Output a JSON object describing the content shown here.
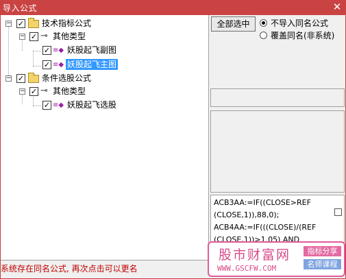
{
  "window": {
    "title": "导入公式",
    "close_glyph": "✕"
  },
  "tree": {
    "root1": {
      "label": "技术指标公式",
      "expander": "−",
      "check": "✓",
      "icon": "folder-icon"
    },
    "group1": {
      "label": "其他类型",
      "expander": "−",
      "check": "✓",
      "icon": "key-icon"
    },
    "item1": {
      "label": "妖股起飞副图",
      "check": "✓",
      "icon": "formula-icon"
    },
    "item2": {
      "label": "妖股起飞主图",
      "check": "✓",
      "icon": "formula-icon",
      "selected": true
    },
    "root2": {
      "label": "条件选股公式",
      "expander": "−",
      "check": "✓",
      "icon": "folder-icon"
    },
    "group2": {
      "label": "其他类型",
      "expander": "−",
      "check": "✓",
      "icon": "key-icon"
    },
    "item3": {
      "label": "妖股起飞选股",
      "check": "✓",
      "icon": "formula-icon"
    }
  },
  "controls": {
    "select_all": "全部选中",
    "radio1": {
      "label": "不导入同名公式",
      "checked": true
    },
    "radio2": {
      "label": "覆盖同名(非系统)",
      "checked": false
    }
  },
  "code": {
    "lines": [
      "ACB3AA:=IF((CLOSE>REF",
      "(CLOSE,1)),88,0);",
      "ACB4AA:=IF(((CLOSE)/(REF",
      "(CLOSE,1))>1.05) AND"
    ]
  },
  "status": "系统存在同名公式, 再次点击可以更名",
  "watermark": {
    "name": "股市财富网",
    "url": "WWW.GSCFW.COM",
    "badge1": "指标分享",
    "badge2": "名师课程"
  },
  "colors": {
    "titlebar": "#c94343",
    "selection": "#3399ff",
    "status_text": "#c00000",
    "watermark": "#d84a8a"
  }
}
